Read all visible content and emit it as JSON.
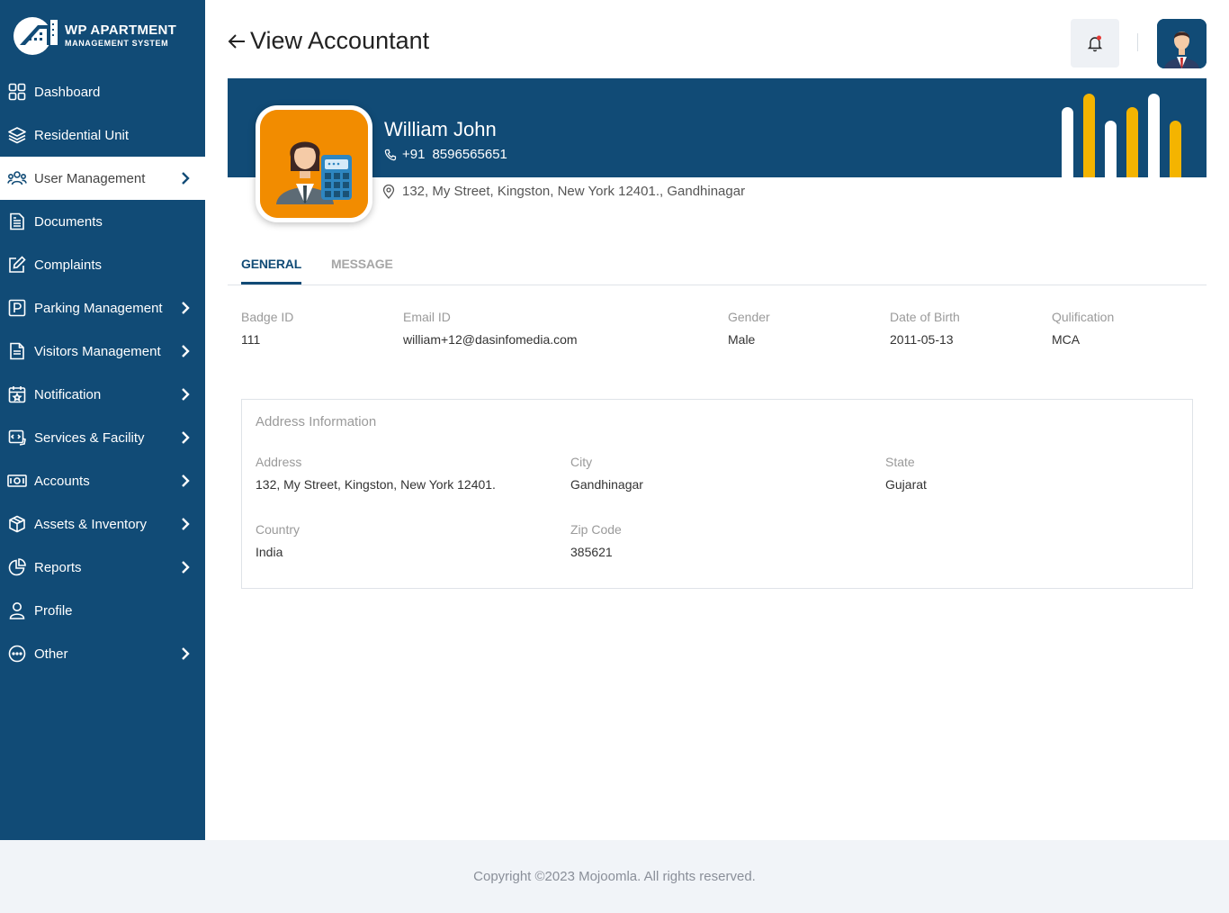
{
  "app": {
    "logo_line1": "WP APARTMENT",
    "logo_line2": "MANAGEMENT SYSTEM",
    "brand_color": "#114b76"
  },
  "sidebar": {
    "items": [
      {
        "label": "Dashboard",
        "icon": "grid-icon",
        "has_submenu": false
      },
      {
        "label": "Residential Unit",
        "icon": "layers-icon",
        "has_submenu": false
      },
      {
        "label": "User Management",
        "icon": "users-icon",
        "has_submenu": true,
        "active": true
      },
      {
        "label": "Documents",
        "icon": "document-icon",
        "has_submenu": false
      },
      {
        "label": "Complaints",
        "icon": "edit-icon",
        "has_submenu": false
      },
      {
        "label": "Parking Management",
        "icon": "parking-icon",
        "has_submenu": true
      },
      {
        "label": "Visitors Management",
        "icon": "file-text-icon",
        "has_submenu": true
      },
      {
        "label": "Notification",
        "icon": "calendar-star-icon",
        "has_submenu": true
      },
      {
        "label": "Services & Facility",
        "icon": "service-icon",
        "has_submenu": true
      },
      {
        "label": "Accounts",
        "icon": "money-icon",
        "has_submenu": true
      },
      {
        "label": "Assets & Inventory",
        "icon": "box-icon",
        "has_submenu": true
      },
      {
        "label": "Reports",
        "icon": "pie-chart-icon",
        "has_submenu": true
      },
      {
        "label": "Profile",
        "icon": "user-icon",
        "has_submenu": false
      },
      {
        "label": "Other",
        "icon": "more-circle-icon",
        "has_submenu": true
      }
    ]
  },
  "header": {
    "title": "View Accountant"
  },
  "profile": {
    "name": "William John",
    "phone_code": "+91",
    "phone": "8596565651",
    "address_line": "132, My Street, Kingston, New York 12401., Gandhinagar"
  },
  "tabs": {
    "general": "GENERAL",
    "message": "MESSAGE"
  },
  "general": {
    "badge_label": "Badge ID",
    "badge_value": "111",
    "email_label": "Email ID",
    "email_value": "william+12@dasinfomedia.com",
    "gender_label": "Gender",
    "gender_value": "Male",
    "dob_label": "Date of Birth",
    "dob_value": "2011-05-13",
    "qual_label": "Qulification",
    "qual_value": "MCA"
  },
  "address_info": {
    "title": "Address Information",
    "address_label": "Address",
    "address_value": "132, My Street, Kingston, New York 12401.",
    "city_label": "City",
    "city_value": "Gandhinagar",
    "state_label": "State",
    "state_value": "Gujarat",
    "country_label": "Country",
    "country_value": "India",
    "zip_label": "Zip Code",
    "zip_value": "385621"
  },
  "footer": {
    "text": "Copyright ©2023 Mojoomla. All rights reserved."
  }
}
